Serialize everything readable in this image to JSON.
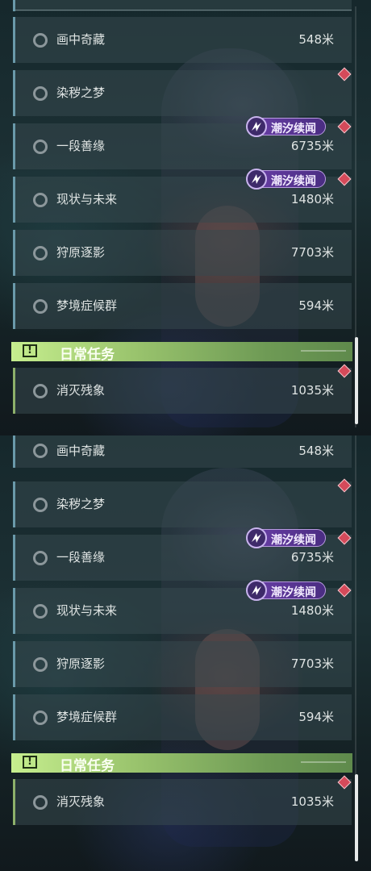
{
  "quest_list": {
    "items": [
      {
        "name": "画中奇藏",
        "distance": "548米"
      },
      {
        "name": "染秽之梦",
        "distance": ""
      },
      {
        "name": "一段善缘",
        "distance": "6735米",
        "tag": "潮汐续闻"
      },
      {
        "name": "现状与未来",
        "distance": "1480米",
        "tag": "潮汐续闻"
      },
      {
        "name": "狩原逐影",
        "distance": "7703米"
      },
      {
        "name": "梦境症候群",
        "distance": "594米"
      }
    ],
    "daily_section": {
      "title": "日常任务",
      "warn_glyph": "!",
      "items": [
        {
          "name": "消灭残象",
          "distance": "1035米"
        }
      ]
    }
  },
  "icons": {
    "quest_status": "hollow-circle-icon",
    "tracking_marker": "red-diamond-icon",
    "tag_badge": "tidal-emblem-icon",
    "daily_header": "exclamation-box-icon"
  },
  "colors": {
    "daily_header": "#9bc56e",
    "quest_tag": "#6a3fa8",
    "marker": "#d54a5a",
    "text": "#dfe4e3"
  }
}
